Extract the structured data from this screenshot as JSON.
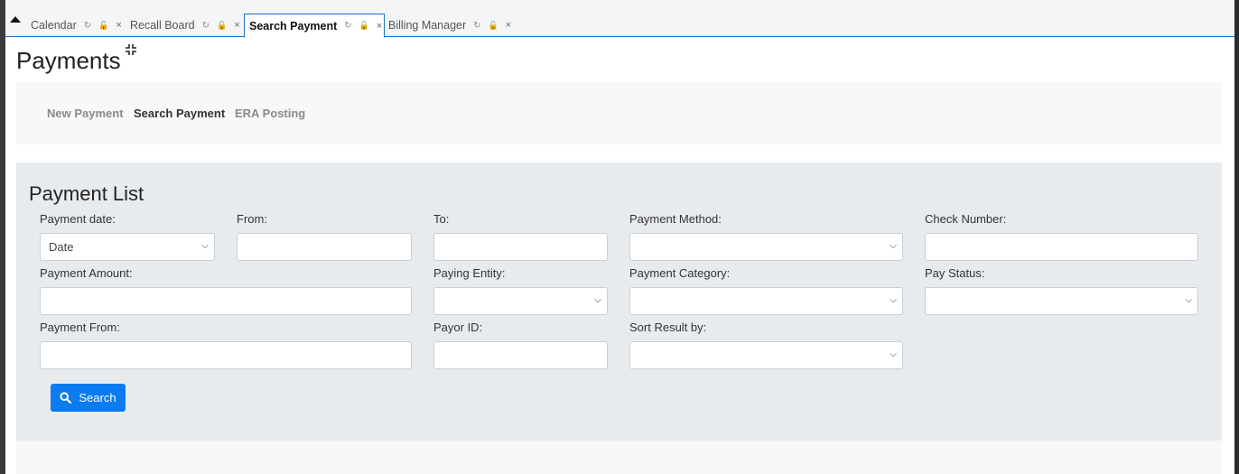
{
  "tabs": [
    {
      "label": "Calendar",
      "active": false
    },
    {
      "label": "Recall Board",
      "active": false
    },
    {
      "label": "Search Payment",
      "active": true
    },
    {
      "label": "Billing Manager",
      "active": false
    }
  ],
  "tab_icons": {
    "refresh": "↻",
    "lock": "🔓",
    "close": "×"
  },
  "page": {
    "title": "Payments"
  },
  "nav": {
    "new_payment": "New Payment",
    "search_payment": "Search Payment",
    "era_posting": "ERA Posting",
    "active": "search_payment"
  },
  "panel": {
    "title": "Payment List",
    "labels": {
      "payment_date": "Payment date:",
      "from": "From:",
      "to": "To:",
      "payment_method": "Payment Method:",
      "check_number": "Check Number:",
      "payment_amount": "Payment Amount:",
      "paying_entity": "Paying Entity:",
      "payment_category": "Payment Category:",
      "pay_status": "Pay Status:",
      "payment_from": "Payment From:",
      "payor_id": "Payor ID:",
      "sort_result_by": "Sort Result by:"
    },
    "values": {
      "payment_date": "Date",
      "from": "",
      "to": "",
      "payment_method": "",
      "check_number": "",
      "payment_amount": "",
      "paying_entity": "",
      "payment_category": "",
      "pay_status": "",
      "payment_from": "",
      "payor_id": "",
      "sort_result_by": ""
    },
    "search_label": "Search"
  },
  "colors": {
    "accent": "#0a7bf0",
    "tab_border": "#1a73c8"
  }
}
